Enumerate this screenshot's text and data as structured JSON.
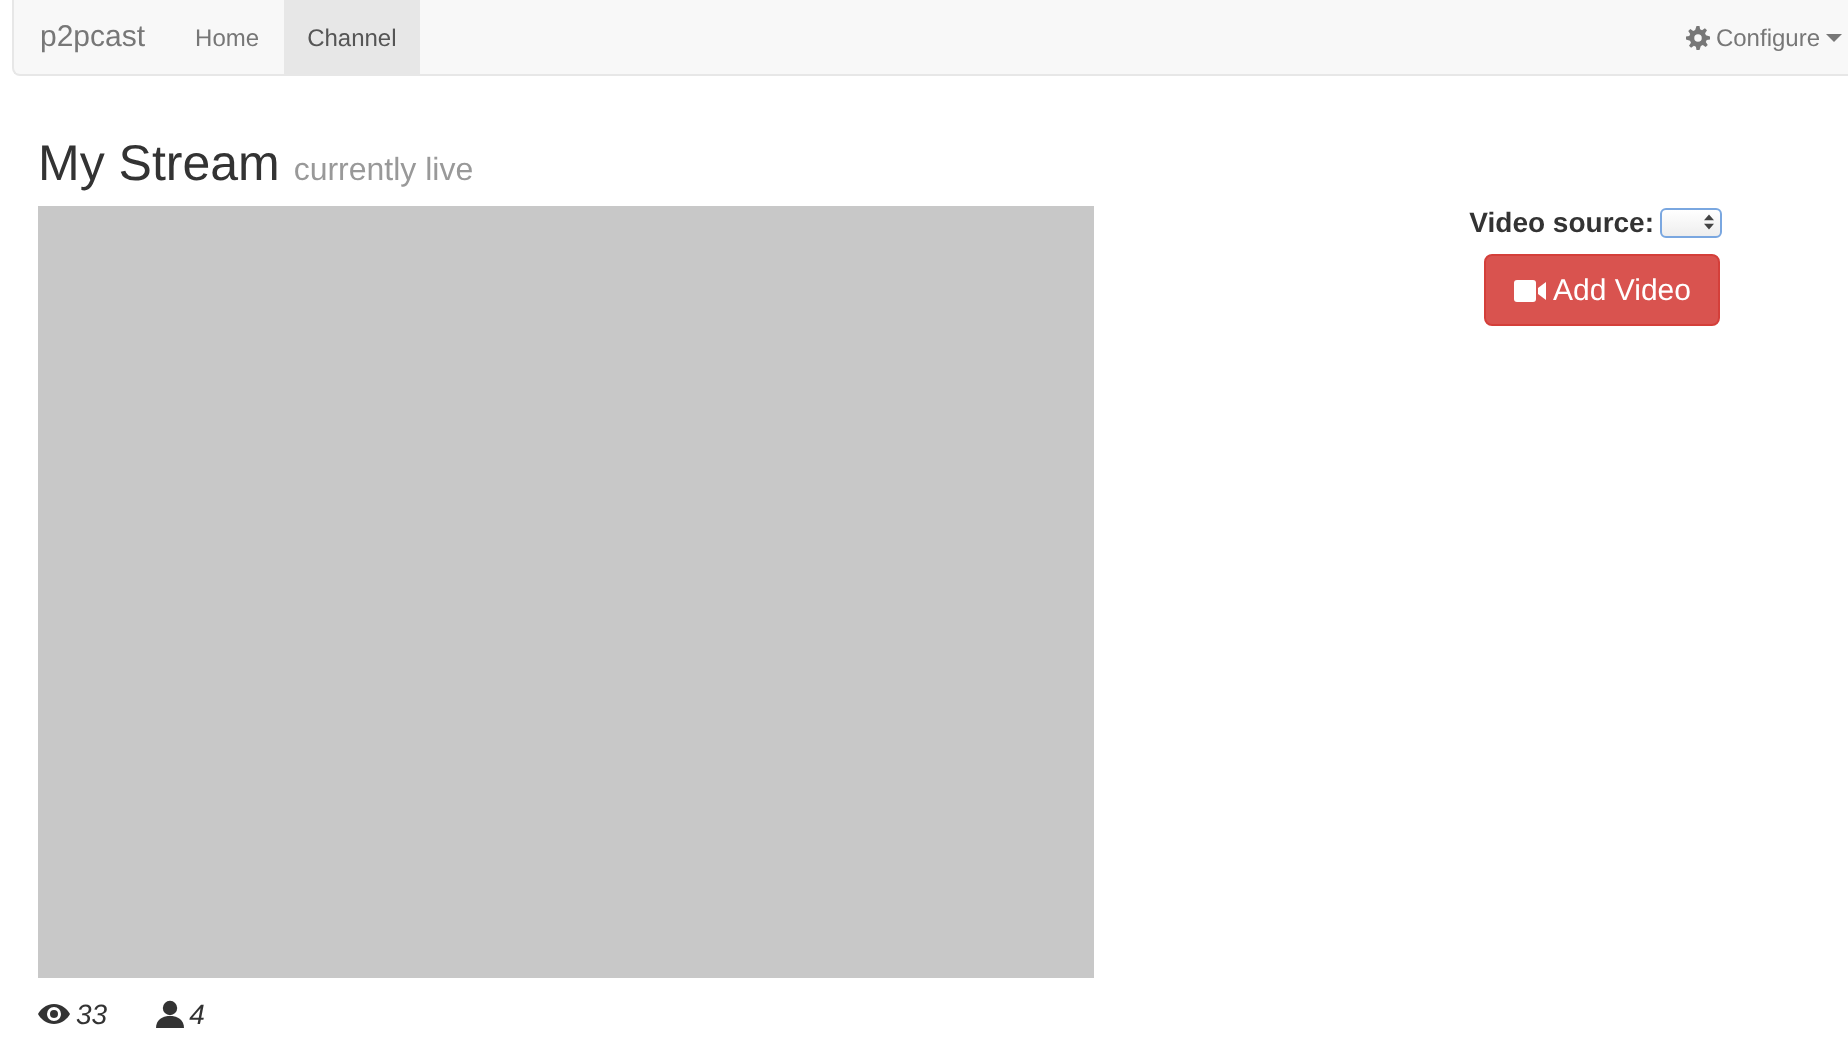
{
  "navbar": {
    "brand": "p2pcast",
    "tabs": [
      {
        "label": "Home",
        "selected": false
      },
      {
        "label": "Channel",
        "selected": true
      }
    ],
    "configure": "Configure"
  },
  "heading": {
    "title": "My Stream",
    "subtitle": "currently live"
  },
  "source": {
    "label": "Video source:"
  },
  "add_button": "Add Video",
  "stats": {
    "views": "33",
    "viewers": "4"
  }
}
